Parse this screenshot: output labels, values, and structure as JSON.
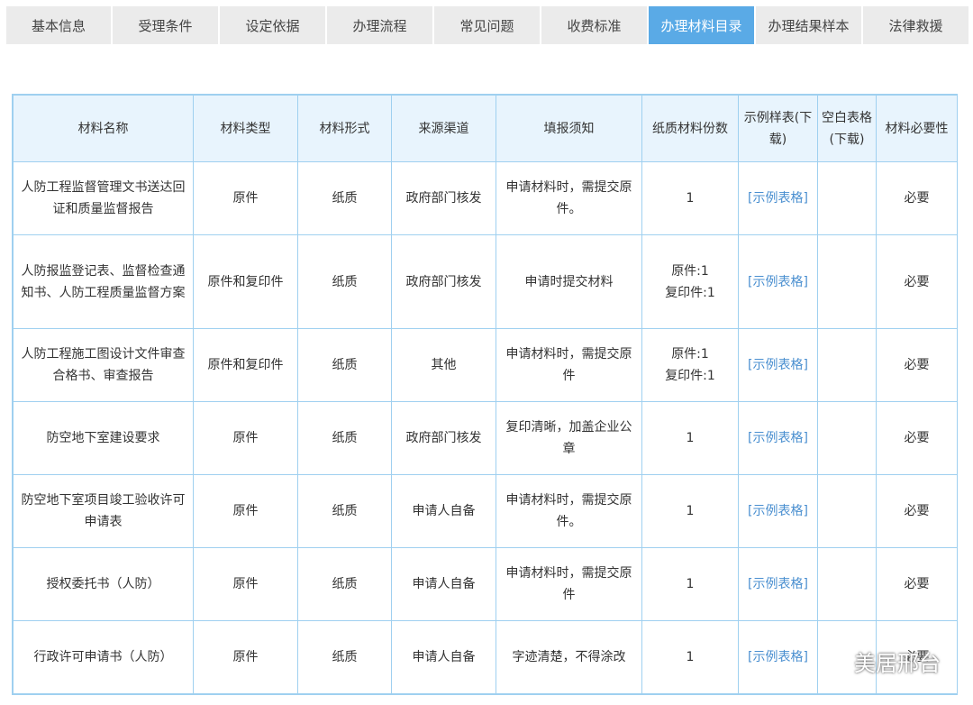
{
  "tabs": [
    {
      "label": "基本信息",
      "active": false
    },
    {
      "label": "受理条件",
      "active": false
    },
    {
      "label": "设定依据",
      "active": false
    },
    {
      "label": "办理流程",
      "active": false
    },
    {
      "label": "常见问题",
      "active": false
    },
    {
      "label": "收费标准",
      "active": false
    },
    {
      "label": "办理材料目录",
      "active": true
    },
    {
      "label": "办理结果样本",
      "active": false
    },
    {
      "label": "法律救援",
      "active": false
    }
  ],
  "table": {
    "headers": [
      "材料名称",
      "材料类型",
      "材料形式",
      "来源渠道",
      "填报须知",
      "纸质材料份数",
      "示例样表(下载)",
      "空白表格(下载)",
      "材料必要性"
    ],
    "rows": [
      {
        "name": "人防工程监督管理文书送达回证和质量监督报告",
        "type": "原件",
        "form": "纸质",
        "source": "政府部门核发",
        "notice": "申请材料时，需提交原件。",
        "copies": [
          "1"
        ],
        "sample": "[示例表格]",
        "blank": "",
        "necessity": "必要"
      },
      {
        "name": "人防报监登记表、监督检查通知书、人防工程质量监督方案",
        "type": "原件和复印件",
        "form": "纸质",
        "source": "政府部门核发",
        "notice": "申请时提交材料",
        "copies": [
          "原件:1",
          "复印件:1"
        ],
        "sample": "[示例表格]",
        "blank": "",
        "necessity": "必要"
      },
      {
        "name": "人防工程施工图设计文件审查合格书、审查报告",
        "type": "原件和复印件",
        "form": "纸质",
        "source": "其他",
        "notice": "申请材料时，需提交原件",
        "copies": [
          "原件:1",
          "复印件:1"
        ],
        "sample": "[示例表格]",
        "blank": "",
        "necessity": "必要"
      },
      {
        "name": "防空地下室建设要求",
        "type": "原件",
        "form": "纸质",
        "source": "政府部门核发",
        "notice": "复印清晰，加盖企业公章",
        "copies": [
          "1"
        ],
        "sample": "[示例表格]",
        "blank": "",
        "necessity": "必要"
      },
      {
        "name": "防空地下室项目竣工验收许可申请表",
        "type": "原件",
        "form": "纸质",
        "source": "申请人自备",
        "notice": "申请材料时，需提交原件。",
        "copies": [
          "1"
        ],
        "sample": "[示例表格]",
        "blank": "",
        "necessity": "必要"
      },
      {
        "name": "授权委托书（人防）",
        "type": "原件",
        "form": "纸质",
        "source": "申请人自备",
        "notice": "申请材料时，需提交原件",
        "copies": [
          "1"
        ],
        "sample": "[示例表格]",
        "blank": "",
        "necessity": "必要"
      },
      {
        "name": "行政许可申请书（人防）",
        "type": "原件",
        "form": "纸质",
        "source": "申请人自备",
        "notice": "字迹清楚，不得涂改",
        "copies": [
          "1"
        ],
        "sample": "[示例表格]",
        "blank": "",
        "necessity": "必要"
      }
    ]
  },
  "watermark": {
    "text": "美居邢台",
    "icon": "wechat-icon"
  },
  "colors": {
    "active_tab": "#5aaae6",
    "tab_bg": "#ebebeb",
    "header_bg": "#e8f4fd",
    "border": "#9fd0f0",
    "link": "#4a8fd0"
  }
}
